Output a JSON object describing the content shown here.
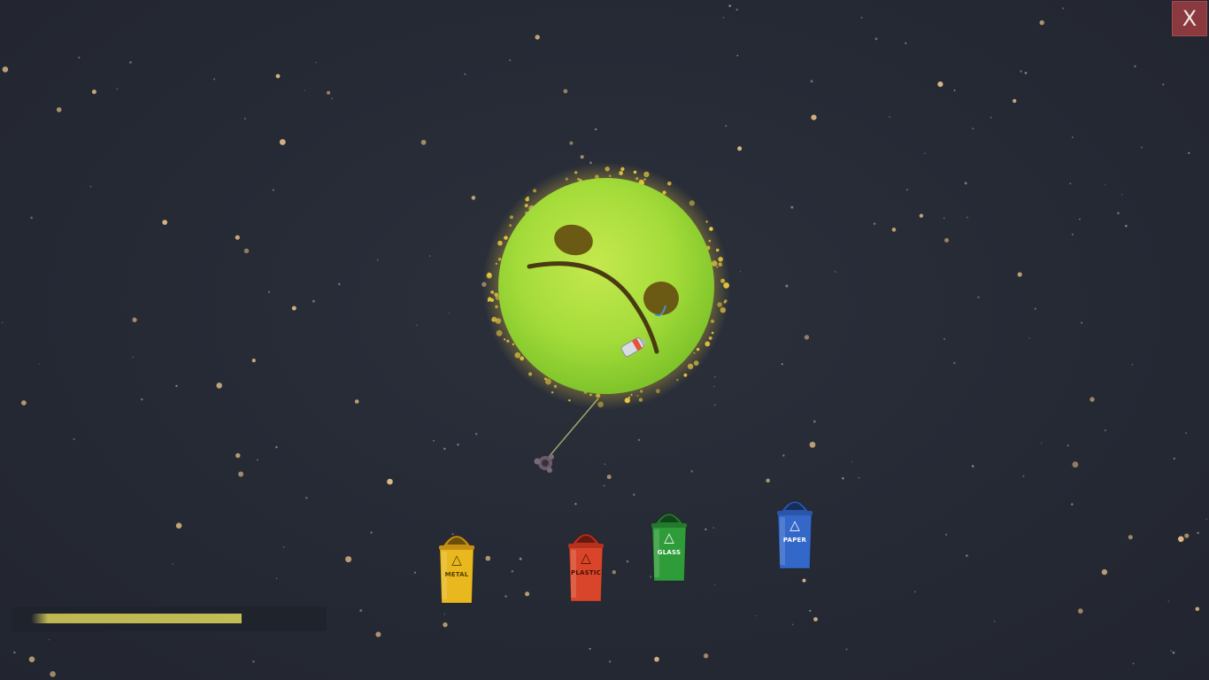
{
  "close_button": {
    "label": "X",
    "icon": "close-icon"
  },
  "planet": {
    "mood": "sad",
    "color": "#9ee03a",
    "glow_color": "#e8c93f"
  },
  "bins": [
    {
      "label": "METAL",
      "color": "#e8b81e",
      "lid_color": "#c58f14",
      "text_color": "#5a4000",
      "icon": "recycle-icon"
    },
    {
      "label": "PLASTIC",
      "color": "#d8452a",
      "lid_color": "#b8301e",
      "text_color": "#4a1000",
      "icon": "recycle-icon"
    },
    {
      "label": "GLASS",
      "color": "#2f9c3a",
      "lid_color": "#247a2c",
      "text_color": "#ffffff",
      "icon": "recycle-icon"
    },
    {
      "label": "PAPER",
      "color": "#3367c8",
      "lid_color": "#2a55a8",
      "text_color": "#ffffff",
      "icon": "recycle-icon"
    }
  ],
  "progress": {
    "value": 0.72,
    "color": "#c2bc55"
  },
  "colors": {
    "background": "#262a35",
    "star": "#e8c088"
  }
}
